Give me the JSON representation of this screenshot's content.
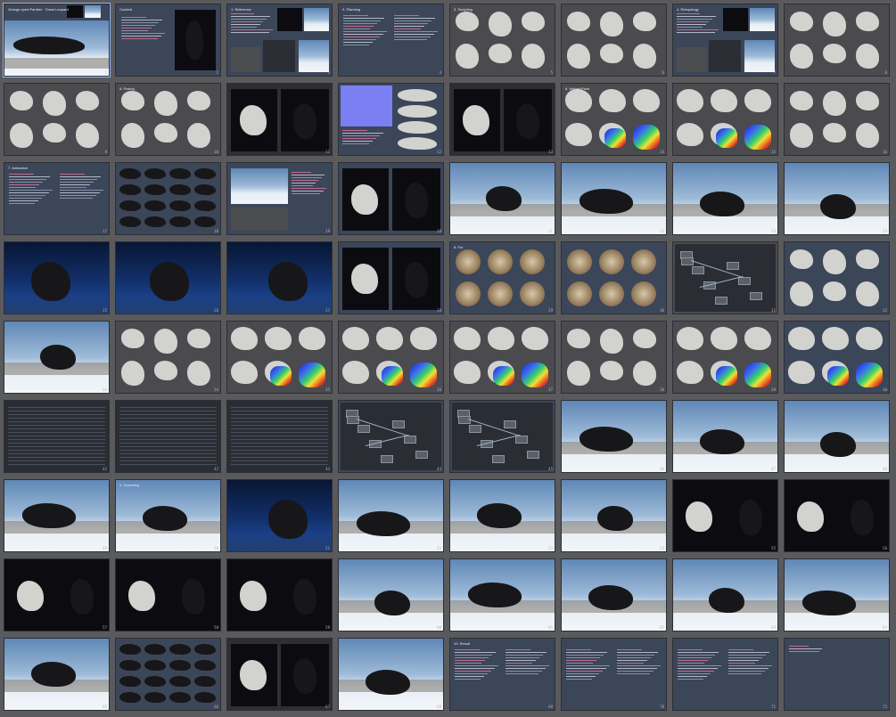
{
  "grid": {
    "columns": 8,
    "rows": 9,
    "background": "#5a5a5c",
    "selected_index": 0
  },
  "slides": [
    {
      "n": "1",
      "kind": "cover",
      "title": "Orange-eyed Panther · Snow Leopard",
      "bg": "#3c4659"
    },
    {
      "n": "2",
      "kind": "toc",
      "title": "Content",
      "bg": "#3c4659"
    },
    {
      "n": "3",
      "kind": "ref",
      "title": "1. Reference",
      "bg": "#3c4659"
    },
    {
      "n": "4",
      "kind": "lines",
      "title": "2. Planning",
      "bg": "#3c4659"
    },
    {
      "n": "5",
      "kind": "sculpt",
      "title": "3. Sculpting",
      "bg": "#4b4b4f"
    },
    {
      "n": "6",
      "kind": "sculpt",
      "title": "",
      "bg": "#4b4b4f"
    },
    {
      "n": "7",
      "kind": "ref",
      "title": "4. Retopology",
      "bg": "#3c4659"
    },
    {
      "n": "8",
      "kind": "sculpt",
      "title": "",
      "bg": "#4b4b4f"
    },
    {
      "n": "9",
      "kind": "sculpt",
      "title": "",
      "bg": "#4b4b4f"
    },
    {
      "n": "10",
      "kind": "sculpt",
      "title": "5. Posing",
      "bg": "#4b4b4f"
    },
    {
      "n": "11",
      "kind": "dark",
      "title": "",
      "bg": "#2d2f33"
    },
    {
      "n": "12",
      "kind": "normal",
      "title": "",
      "bg": "#3c4659"
    },
    {
      "n": "13",
      "kind": "dark",
      "title": "",
      "bg": "#2d2f33"
    },
    {
      "n": "14",
      "kind": "heat",
      "title": "6. Weight Paint",
      "bg": "#4b4b4f"
    },
    {
      "n": "15",
      "kind": "heat",
      "title": "",
      "bg": "#4b4b4f"
    },
    {
      "n": "16",
      "kind": "sculpt",
      "title": "",
      "bg": "#4b4b4f"
    },
    {
      "n": "17",
      "kind": "lines",
      "title": "7. Animation",
      "bg": "#3c4659"
    },
    {
      "n": "18",
      "kind": "strip",
      "title": "",
      "bg": "#3c4659"
    },
    {
      "n": "19",
      "kind": "sky",
      "title": "",
      "bg": "#3c4659"
    },
    {
      "n": "20",
      "kind": "dark",
      "title": "",
      "bg": "#3c4659"
    },
    {
      "n": "21",
      "kind": "render",
      "title": "",
      "bg": "#9ebbd8"
    },
    {
      "n": "22",
      "kind": "render",
      "title": "",
      "bg": "#9ebbd8"
    },
    {
      "n": "23",
      "kind": "render",
      "title": "",
      "bg": "#9ebbd8"
    },
    {
      "n": "24",
      "kind": "render",
      "title": "",
      "bg": "#9ebbd8"
    },
    {
      "n": "25",
      "kind": "night",
      "title": "",
      "bg": "#12306b"
    },
    {
      "n": "26",
      "kind": "night",
      "title": "",
      "bg": "#12306b"
    },
    {
      "n": "27",
      "kind": "night",
      "title": "",
      "bg": "#12306b"
    },
    {
      "n": "28",
      "kind": "dark",
      "title": "",
      "bg": "#3c4659"
    },
    {
      "n": "29",
      "kind": "fur",
      "title": "8. Fur",
      "bg": "#3c4659"
    },
    {
      "n": "30",
      "kind": "fur",
      "title": "",
      "bg": "#3c4659"
    },
    {
      "n": "31",
      "kind": "nodes",
      "title": "",
      "bg": "#4b4b4f"
    },
    {
      "n": "32",
      "kind": "sculpt",
      "title": "",
      "bg": "#3c4659"
    },
    {
      "n": "33",
      "kind": "render",
      "title": "",
      "bg": "#9ebbd8"
    },
    {
      "n": "34",
      "kind": "sculpt",
      "title": "",
      "bg": "#4b4b4f"
    },
    {
      "n": "35",
      "kind": "heat",
      "title": "",
      "bg": "#4b4b4f"
    },
    {
      "n": "36",
      "kind": "heat",
      "title": "",
      "bg": "#4b4b4f"
    },
    {
      "n": "37",
      "kind": "heat",
      "title": "",
      "bg": "#4b4b4f"
    },
    {
      "n": "38",
      "kind": "sculpt",
      "title": "",
      "bg": "#4b4b4f"
    },
    {
      "n": "39",
      "kind": "heat",
      "title": "",
      "bg": "#4b4b4f"
    },
    {
      "n": "40",
      "kind": "heat",
      "title": "",
      "bg": "#3c4659"
    },
    {
      "n": "41",
      "kind": "table",
      "title": "",
      "bg": "#2a2d33"
    },
    {
      "n": "42",
      "kind": "table",
      "title": "",
      "bg": "#2a2d33"
    },
    {
      "n": "43",
      "kind": "table",
      "title": "",
      "bg": "#2a2d33"
    },
    {
      "n": "44",
      "kind": "nodes",
      "title": "",
      "bg": "#3c4659"
    },
    {
      "n": "45",
      "kind": "nodes",
      "title": "",
      "bg": "#3c4659"
    },
    {
      "n": "46",
      "kind": "render",
      "title": "",
      "bg": "#3c4659"
    },
    {
      "n": "47",
      "kind": "render",
      "title": "",
      "bg": "#3c4659"
    },
    {
      "n": "48",
      "kind": "render",
      "title": "",
      "bg": "#3c4659"
    },
    {
      "n": "49",
      "kind": "render",
      "title": "",
      "bg": "#3c4659"
    },
    {
      "n": "50",
      "kind": "render",
      "title": "9. Grooming",
      "bg": "#3c4659"
    },
    {
      "n": "51",
      "kind": "night",
      "title": "",
      "bg": "#3c4659"
    },
    {
      "n": "52",
      "kind": "render",
      "title": "",
      "bg": "#6a8fb9"
    },
    {
      "n": "53",
      "kind": "render",
      "title": "",
      "bg": "#9ebbd8"
    },
    {
      "n": "54",
      "kind": "render",
      "title": "",
      "bg": "#9ebbd8"
    },
    {
      "n": "55",
      "kind": "dark",
      "title": "",
      "bg": "#0c0c10"
    },
    {
      "n": "56",
      "kind": "dark",
      "title": "",
      "bg": "#0c0c10"
    },
    {
      "n": "57",
      "kind": "dark",
      "title": "",
      "bg": "#0c0c10"
    },
    {
      "n": "58",
      "kind": "dark",
      "title": "",
      "bg": "#0c0c10"
    },
    {
      "n": "59",
      "kind": "dark",
      "title": "",
      "bg": "#0c0c10"
    },
    {
      "n": "60",
      "kind": "render",
      "title": "",
      "bg": "#9ebbd8"
    },
    {
      "n": "61",
      "kind": "render",
      "title": "",
      "bg": "#9ebbd8"
    },
    {
      "n": "62",
      "kind": "render",
      "title": "",
      "bg": "#9ebbd8"
    },
    {
      "n": "63",
      "kind": "render",
      "title": "",
      "bg": "#9ebbd8"
    },
    {
      "n": "64",
      "kind": "render",
      "title": "",
      "bg": "#9ebbd8"
    },
    {
      "n": "65",
      "kind": "render",
      "title": "",
      "bg": "#9ebbd8"
    },
    {
      "n": "66",
      "kind": "strip",
      "title": "",
      "bg": "#3c4659"
    },
    {
      "n": "67",
      "kind": "dark",
      "title": "",
      "bg": "#2d2f33"
    },
    {
      "n": "68",
      "kind": "render",
      "title": "",
      "bg": "#3c4659"
    },
    {
      "n": "69",
      "kind": "lines",
      "title": "10. Result",
      "bg": "#3c4659"
    },
    {
      "n": "70",
      "kind": "lines",
      "title": "",
      "bg": "#3c4659"
    },
    {
      "n": "71",
      "kind": "lines",
      "title": "",
      "bg": "#3c4659"
    },
    {
      "n": "72",
      "kind": "blank",
      "title": "",
      "bg": "#3c4659"
    }
  ]
}
